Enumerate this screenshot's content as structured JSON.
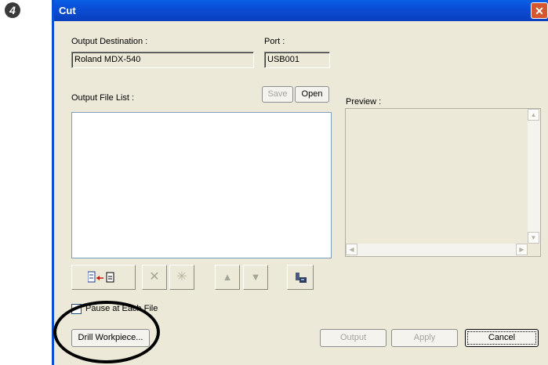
{
  "step_marker": "4",
  "window": {
    "title": "Cut",
    "close_glyph": "✕"
  },
  "output_destination": {
    "label": "Output Destination :",
    "value": "Roland MDX-540"
  },
  "port": {
    "label": "Port :",
    "value": "USB001"
  },
  "file_list": {
    "label": "Output File List :",
    "save_label": "Save",
    "open_label": "Open"
  },
  "preview": {
    "label": "Preview :"
  },
  "toolbar": {
    "add_icon": "add-file-icon",
    "delete_glyph": "✕",
    "settings_glyph": "✳",
    "up_glyph": "▲",
    "down_glyph": "▼"
  },
  "pause_checkbox": {
    "label": "Pause at Each File",
    "checked": false
  },
  "buttons": {
    "drill_workpiece": "Drill Workpiece...",
    "output": "Output",
    "apply": "Apply",
    "cancel": "Cancel"
  },
  "colors": {
    "titlebar": "#0b4ed6",
    "dialog_bg": "#ece9d8",
    "disabled_text": "#a5a59a"
  }
}
